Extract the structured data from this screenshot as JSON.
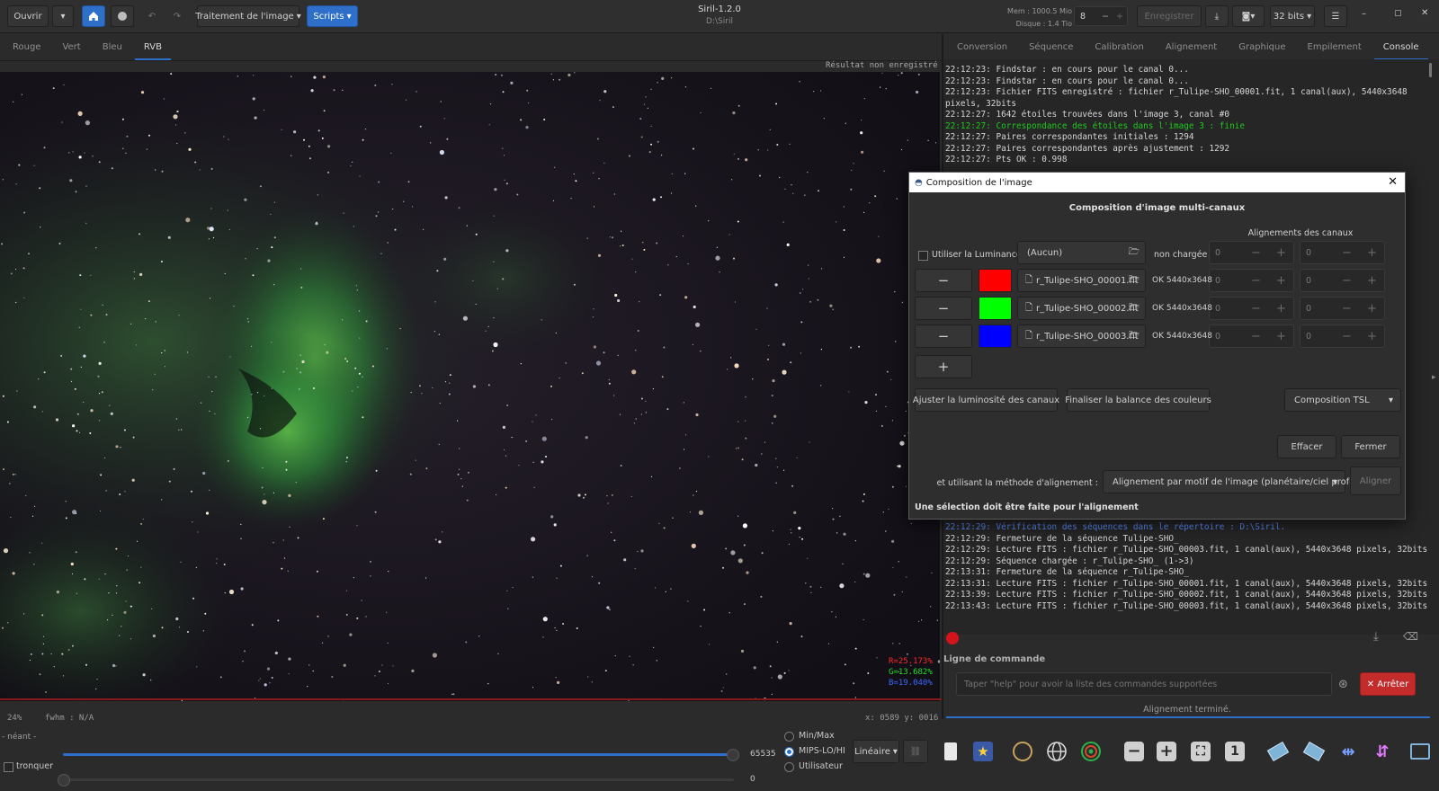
{
  "header": {
    "open_label": "Ouvrir",
    "image_processing_label": "Traitement de l'image",
    "scripts_label": "Scripts",
    "app_title": "Siril-1.2.0",
    "app_path": "D:\\Siril",
    "mem_label": "Mem : 1000.5 Mio",
    "disk_label": "Disque : 1.4 Tio",
    "threads_value": "8",
    "save_label": "Enregistrer",
    "bitdepth_label": "32 bits"
  },
  "view_tabs": [
    "Rouge",
    "Vert",
    "Bleu",
    "RVB"
  ],
  "panel_tabs": [
    "Conversion",
    "Séquence",
    "Calibration",
    "Alignement",
    "Graphique",
    "Empilement",
    "Console"
  ],
  "image": {
    "unsaved_label": "Résultat non enregistré",
    "r_value": "R=25.173%",
    "g_value": "G=13.682%",
    "b_value": "B=19.040%"
  },
  "status": {
    "zoom": "24%",
    "fwhm": "fwhm : N/A",
    "coords": "x: 0589 y: 0016",
    "neant": "- néant -"
  },
  "console": {
    "lines_top": [
      "22:12:23: Findstar : en cours pour le canal 0...",
      "22:12:23: Findstar : en cours pour le canal 0...",
      "22:12:23: Fichier FITS enregistré : fichier r_Tulipe-SHO_00001.fit, 1 canal(aux), 5440x3648",
      "pixels, 32bits",
      "22:12:27: 1642 étoiles trouvées dans l'image 3, canal #0",
      "22:12:27: Correspondance des étoiles dans l'image 3 : finie",
      "22:12:27: Paires correspondantes initiales : 1294",
      "22:12:27: Paires correspondantes après ajustement : 1292",
      "22:12:27: Pts OK :       0.998"
    ],
    "lines_bottom": [
      "22:12:29: Vérification des séquences dans le répertoire : D:\\Siril.",
      "22:12:29: Fermeture de la séquence Tulipe-SHO_",
      "22:12:29: Lecture FITS : fichier r_Tulipe-SHO_00003.fit, 1 canal(aux), 5440x3648 pixels, 32bits",
      "22:12:29: Séquence chargée : r_Tulipe-SHO_ (1->3)",
      "22:13:31: Fermeture de la séquence r_Tulipe-SHO_",
      "22:13:31: Lecture FITS : fichier r_Tulipe-SHO_00001.fit, 1 canal(aux), 5440x3648 pixels, 32bits",
      "22:13:39: Lecture FITS : fichier r_Tulipe-SHO_00002.fit, 1 canal(aux), 5440x3648 pixels, 32bits",
      "22:13:43: Lecture FITS : fichier r_Tulipe-SHO_00003.fit, 1 canal(aux), 5440x3648 pixels, 32bits"
    ],
    "command_label": "Ligne de commande",
    "command_placeholder": "Taper \"help\" pour avoir la liste des commandes supportées",
    "stop_label": "Arrêter",
    "status_text": "Alignement terminé."
  },
  "dialog": {
    "title": "Composition de l'image",
    "heading": "Composition d'image multi-canaux",
    "alignments_label": "Alignements des canaux",
    "luminance_label": "Utiliser la Luminance",
    "luminance_file": "(Aucun)",
    "luminance_status": "non chargée",
    "channels": [
      {
        "file": "r_Tulipe-SHO_00001.fit",
        "status": "OK 5440x3648",
        "color": "#ff0000"
      },
      {
        "file": "r_Tulipe-SHO_00002.fit",
        "status": "OK 5440x3648",
        "color": "#00ff00"
      },
      {
        "file": "r_Tulipe-SHO_00003.fit",
        "status": "OK 5440x3648",
        "color": "#0000ff"
      }
    ],
    "spin_zero": "0",
    "adjust_label": "Ajuster la luminosité des canaux",
    "balance_label": "Finaliser la balance des couleurs",
    "composition_mode": "Composition TSL",
    "clear_label": "Effacer",
    "close_label": "Fermer",
    "method_label": "et utilisant la méthode d'alignement :",
    "method_value": "Alignement par motif de l'image (planétaire/ciel profond)",
    "align_label": "Aligner",
    "warning": "Une sélection doit être faite pour l'alignement"
  },
  "bottom": {
    "max_value": "65535",
    "min_value": "0",
    "truncate_label": "tronquer",
    "minmax_label": "Min/Max",
    "mips_label": "MIPS-LO/HI",
    "user_label": "Utilisateur",
    "stretch_label": "Linéaire",
    "one_label": "1"
  },
  "colors": {
    "accent": "#2d6fc9",
    "stop": "#c42b2b",
    "green_text": "#1ec81e",
    "blue_text": "#5a8cff"
  }
}
